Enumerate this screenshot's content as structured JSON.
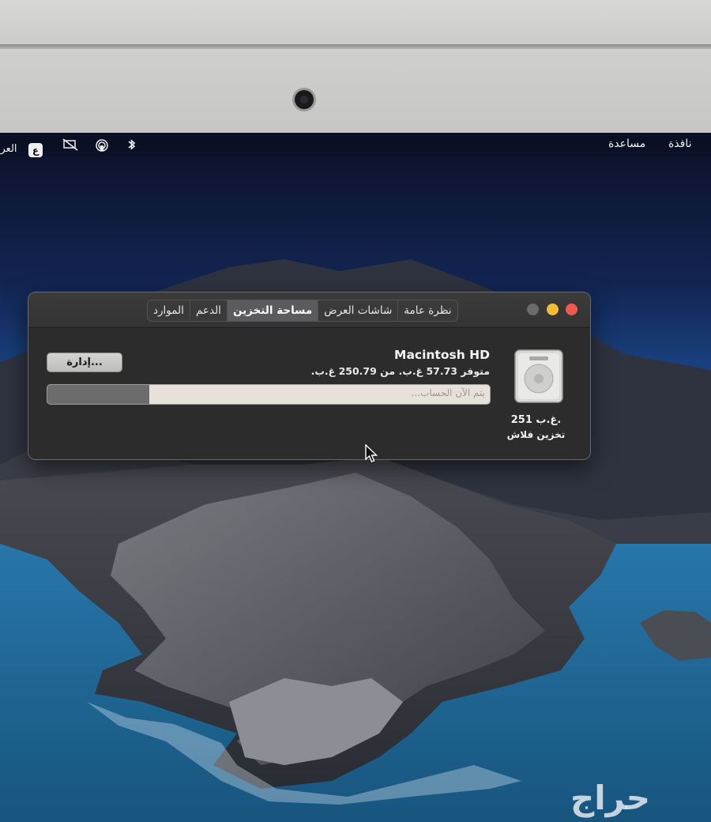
{
  "menubar": {
    "right_items": [
      "نافذة",
      "مساعدة"
    ],
    "input_language": "العربية",
    "language_badge": "ع",
    "status_icons": [
      "bluetooth-icon",
      "airdrop-icon",
      "airplay-muted-icon"
    ]
  },
  "window": {
    "tabs": [
      "نظرة عامة",
      "شاشات العرض",
      "مساحة التخزين",
      "الدعم",
      "الموارد"
    ],
    "active_tab": "مساحة التخزين",
    "disk": {
      "name": "Macintosh HD",
      "availability": "متوفر 57.73 غ.ب. من 250.79 غ.ب.",
      "capacity": "251 غ.ب.",
      "type": "تخزين فلاش",
      "icon": "hard-drive-icon"
    },
    "manage_button": "إدارة...",
    "usage_bar": {
      "label": "يتم الآن الحساب...",
      "used_fraction": 0.23
    },
    "traffic_lights": {
      "close": "#ee5a52",
      "minimize": "#f2bd34",
      "zoom": "#6b6b6b"
    }
  },
  "watermark": "حراج"
}
